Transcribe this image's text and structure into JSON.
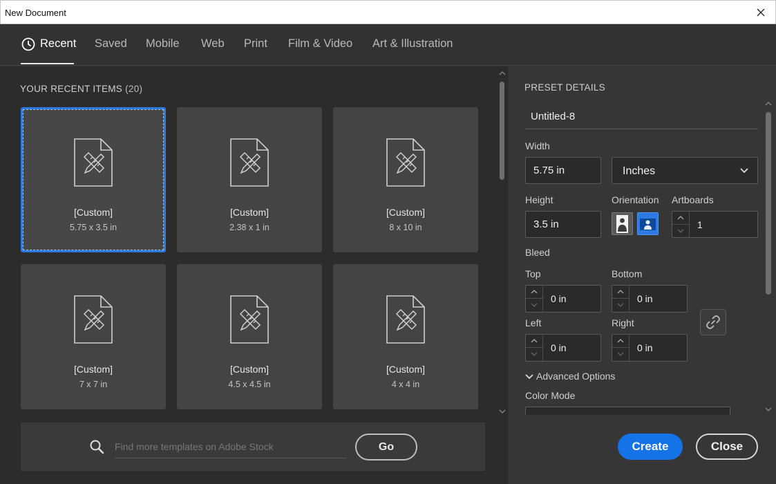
{
  "window": {
    "title": "New Document"
  },
  "tabs": [
    {
      "label": "Recent"
    },
    {
      "label": "Saved"
    },
    {
      "label": "Mobile"
    },
    {
      "label": "Web"
    },
    {
      "label": "Print"
    },
    {
      "label": "Film & Video"
    },
    {
      "label": "Art & Illustration"
    }
  ],
  "recent": {
    "title": "YOUR RECENT ITEMS",
    "count": "(20)",
    "items": [
      {
        "name": "[Custom]",
        "size": "5.75 x 3.5 in"
      },
      {
        "name": "[Custom]",
        "size": "2.38 x 1 in"
      },
      {
        "name": "[Custom]",
        "size": "8 x 10 in"
      },
      {
        "name": "[Custom]",
        "size": "7 x 7 in"
      },
      {
        "name": "[Custom]",
        "size": "4.5 x 4.5 in"
      },
      {
        "name": "[Custom]",
        "size": "4 x 4 in"
      }
    ]
  },
  "search": {
    "placeholder": "Find more templates on Adobe Stock",
    "go_label": "Go"
  },
  "preset": {
    "header": "PRESET DETAILS",
    "name": "Untitled-8",
    "width_label": "Width",
    "width_value": "5.75 in",
    "units_value": "Inches",
    "height_label": "Height",
    "height_value": "3.5 in",
    "orientation_label": "Orientation",
    "artboards_label": "Artboards",
    "artboards_value": "1",
    "bleed_label": "Bleed",
    "top_label": "Top",
    "top_value": "0 in",
    "bottom_label": "Bottom",
    "bottom_value": "0 in",
    "left_label": "Left",
    "left_value": "0 in",
    "right_label": "Right",
    "right_value": "0 in",
    "advanced_label": "Advanced Options",
    "color_mode_label": "Color Mode"
  },
  "actions": {
    "create_label": "Create",
    "close_label": "Close"
  },
  "colors": {
    "accent": "#1473e6",
    "selection": "#2d7be2",
    "panel": "#2c2c2c",
    "card": "#444444"
  }
}
